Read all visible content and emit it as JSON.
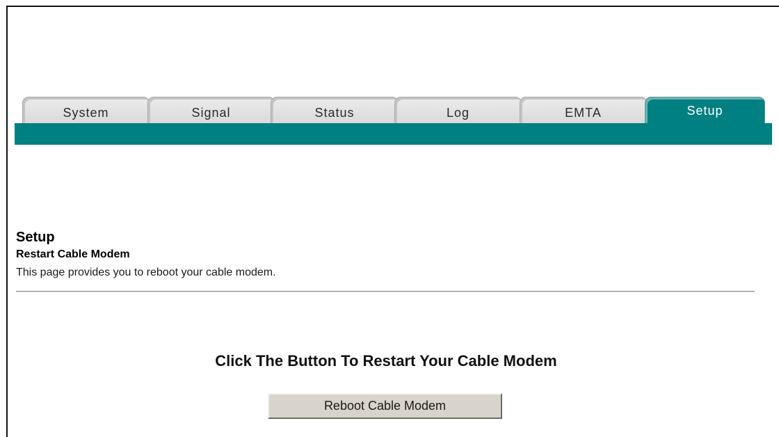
{
  "tabs": [
    {
      "label": "System",
      "active": false
    },
    {
      "label": "Signal",
      "active": false
    },
    {
      "label": "Status",
      "active": false
    },
    {
      "label": "Log",
      "active": false
    },
    {
      "label": "EMTA",
      "active": false
    },
    {
      "label": "Setup",
      "active": true
    }
  ],
  "colors": {
    "accent": "#008080",
    "tab_inactive": "#dadada",
    "button": "#d8d4cc"
  },
  "page": {
    "title": "Setup",
    "subtitle": "Restart Cable Modem",
    "description": "This page provides you to reboot your cable modem."
  },
  "action": {
    "instruction": "Click The Button To Restart Your Cable Modem",
    "button_label": "Reboot Cable Modem"
  }
}
